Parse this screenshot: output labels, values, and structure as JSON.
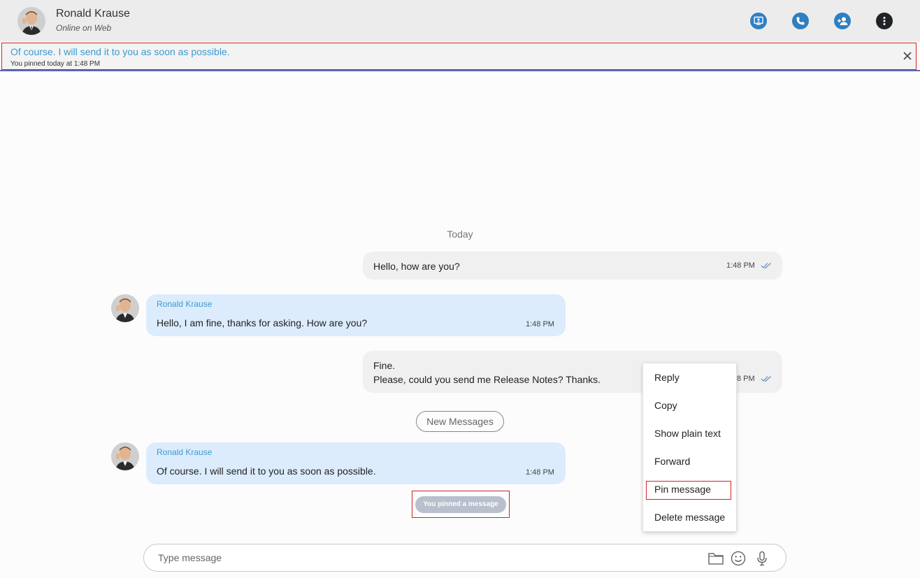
{
  "header": {
    "contact_name": "Ronald Krause",
    "contact_status": "Online on Web",
    "actions": [
      {
        "name": "screen-share-icon"
      },
      {
        "name": "phone-icon"
      },
      {
        "name": "add-contact-icon"
      },
      {
        "name": "more-options-icon"
      }
    ]
  },
  "pinned": {
    "text": "Of course. I will send it to you as soon as possible.",
    "meta": "You pinned today at 1:48 PM"
  },
  "chat": {
    "date_label": "Today",
    "new_messages_label": "New Messages",
    "system_note": "You pinned a message",
    "messages": [
      {
        "direction": "out",
        "lines": [
          "Hello, how are you?"
        ],
        "time": "1:48 PM",
        "read": true
      },
      {
        "direction": "in",
        "sender": "Ronald Krause",
        "lines": [
          "Hello, I am fine, thanks for asking. How are you?"
        ],
        "time": "1:48 PM"
      },
      {
        "direction": "out",
        "lines": [
          "Fine.",
          "Please, could you send me Release Notes? Thanks."
        ],
        "time": "1:48 PM",
        "time_visible": "8 PM",
        "read": true
      },
      {
        "direction": "in",
        "sender": "Ronald Krause",
        "lines": [
          "Of course. I will send it to you as soon as possible."
        ],
        "time": "1:48 PM"
      }
    ]
  },
  "context_menu": {
    "items": [
      "Reply",
      "Copy",
      "Show plain text",
      "Forward",
      "Pin message",
      "Delete message"
    ],
    "highlighted": "Pin message"
  },
  "composer": {
    "placeholder": "Type message"
  },
  "colors": {
    "accent": "#2f7fc1",
    "sender": "#3a9ad0",
    "incoming_bubble": "#dcecfd",
    "outgoing_bubble": "#f0f0f0",
    "highlight_border": "#d2232a"
  }
}
